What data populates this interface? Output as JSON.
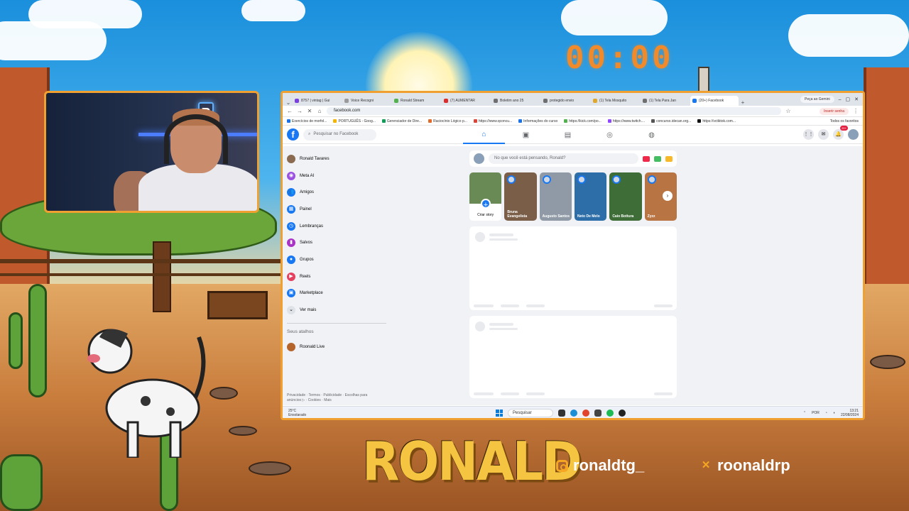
{
  "overlay": {
    "timer": "00:00",
    "brand": "RONALD",
    "instagram": "ronaldtg_",
    "x_handle": "roonaldrp",
    "webcam_logo": "R"
  },
  "browser": {
    "tabs": [
      {
        "label": "8757 | vintag | Gui",
        "color": "#7b3fe4"
      },
      {
        "label": "Voice Recogni",
        "color": "#9b9b9b"
      },
      {
        "label": "Ronald Stream",
        "color": "#53b14e"
      },
      {
        "label": "(7) AUMENTAR",
        "color": "#e02b2b"
      },
      {
        "label": "Boletim ano 25",
        "color": "#6f6f6f"
      },
      {
        "label": "protegido envio",
        "color": "#6f6f6f"
      },
      {
        "label": "(1) Tela Mosquito",
        "color": "#e0a82b"
      },
      {
        "label": "(1) Tela Para Jan",
        "color": "#6f6f6f"
      },
      {
        "label": "(20+) Facebook",
        "color": "#1877f2"
      }
    ],
    "new_tab": "+",
    "gemini": "Peça ao Gemini",
    "url": "facebook.com",
    "exit_guest": "Inserir senha",
    "bookmarks": [
      "Exercícios de morfol...",
      "PORTUGUÊS - Goog...",
      "Gerenciador de Dire...",
      "Raciocínio Lógico p...",
      "https://www.qconcu...",
      "Informações do curso",
      "https://kick.com/po...",
      "https://www.twitch....",
      "concurso.idecan.org...",
      "https://vctiktok.com..."
    ],
    "all_bookmarks": "Todos os favoritos"
  },
  "facebook": {
    "search_placeholder": "Pesquisar no Facebook",
    "notification_badge": "20+",
    "left_nav": [
      {
        "label": "Ronald Tavares",
        "icon": "avatar",
        "color": "#8a6a50"
      },
      {
        "label": "Meta AI",
        "icon": "meta-ai-icon",
        "color": "#9b51e0"
      },
      {
        "label": "Amigos",
        "icon": "friends-icon",
        "color": "#1877f2"
      },
      {
        "label": "Painel",
        "icon": "dashboard-icon",
        "color": "#1877f2"
      },
      {
        "label": "Lembranças",
        "icon": "memories-icon",
        "color": "#1877f2"
      },
      {
        "label": "Salvos",
        "icon": "saved-icon",
        "color": "#a933c7"
      },
      {
        "label": "Grupos",
        "icon": "groups-icon",
        "color": "#1877f2"
      },
      {
        "label": "Reels",
        "icon": "reels-icon",
        "color": "#e4405f"
      },
      {
        "label": "Marketplace",
        "icon": "marketplace-icon",
        "color": "#1877f2"
      },
      {
        "label": "Ver mais",
        "icon": "chevron-down-icon",
        "color": "#dfe3e8"
      }
    ],
    "shortcuts_heading": "Seus atalhos",
    "shortcut": "Roonald Live",
    "footer": "Privacidade · Termos · Publicidade · Escolhas para anúncios ▷ · Cookies · Mais",
    "composer_placeholder": "No que você está pensando, Ronald?",
    "create_story": "Criar story",
    "stories": [
      {
        "name": "Bruna Evangelista",
        "color": "#7a5e48"
      },
      {
        "name": "Augusto Santos",
        "color": "#8f9aa6"
      },
      {
        "name": "Neto De Melo",
        "color": "#2e6ea8"
      },
      {
        "name": "Caio Bottura",
        "color": "#3f6d38"
      },
      {
        "name": "Zyzz",
        "color": "#b87543"
      }
    ]
  },
  "taskbar": {
    "temperature": "25°C",
    "weather": "Ensolarado",
    "search": "Pesquisar",
    "language": "POR",
    "time": "13:21",
    "date": "22/08/2024"
  }
}
